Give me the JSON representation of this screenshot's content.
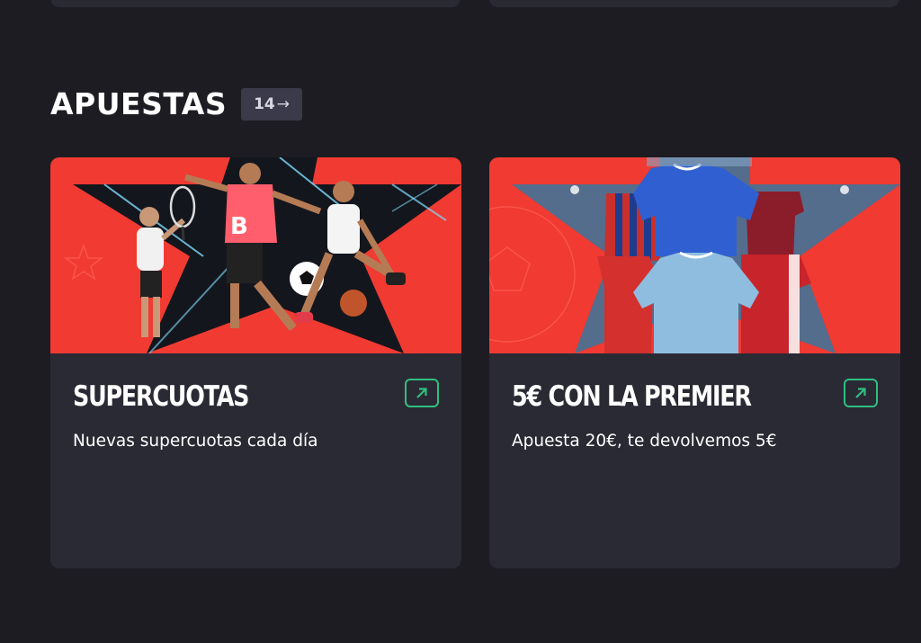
{
  "section": {
    "title": "APUESTAS",
    "count": "14",
    "count_arrow": "→"
  },
  "cards": [
    {
      "title": "SUPERCUOTAS",
      "description": "Nuevas supercuotas cada día",
      "badge_letter": "B"
    },
    {
      "title": "5€ CON LA PREMIER",
      "description": "Apuesta 20€, te devolvemos 5€"
    }
  ],
  "colors": {
    "background": "#1d1c22",
    "card": "#2a2a35",
    "badge": "#3a3a4a",
    "banner_red": "#f03a32",
    "accent_green": "#2fbf7f"
  },
  "icons": {
    "external_link": "external-link-icon",
    "arrow": "arrow-right-icon"
  }
}
